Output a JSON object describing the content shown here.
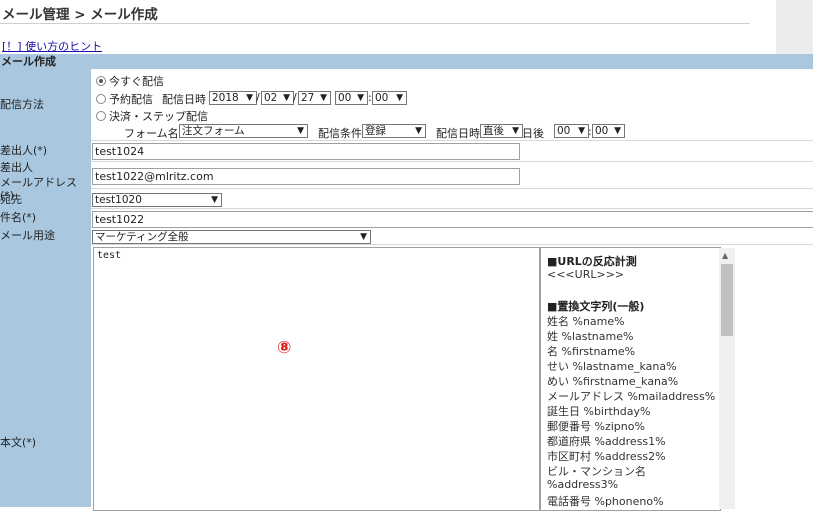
{
  "page": {
    "title": "メール管理 > メール作成",
    "hint_link": "[！] 使い方のヒント",
    "section_title": "メール作成"
  },
  "delivery": {
    "label": "配信方法",
    "opt_now": "今すぐ配信",
    "opt_scheduled": "予約配信",
    "schedule_label": "配信日時",
    "year": "2018",
    "month": "02",
    "day": "27",
    "hour": "00",
    "minute": "00",
    "sep_slash": "/",
    "sep_colon": ":",
    "opt_step": "決済・ステップ配信",
    "form_name_label": "フォーム名",
    "form_name_value": "注文フォーム",
    "condition_label": "配信条件",
    "condition_value": "登録",
    "step_time_label": "配信日時",
    "step_time_value": "直後",
    "days_after": "日後",
    "step_hour": "00",
    "step_minute": "00",
    "selected": "now"
  },
  "sender": {
    "label": "差出人(*)",
    "value": "test1024"
  },
  "sender_address": {
    "label_line1": "差出人",
    "label_line2": "メールアドレス(*)",
    "value": "test1022@mlritz.com"
  },
  "recipient": {
    "label": "宛先",
    "value": "test1020"
  },
  "subject": {
    "label": "件名(*)",
    "value": "test1022"
  },
  "purpose": {
    "label": "メール用途",
    "value": "マーケティング全般"
  },
  "body": {
    "label": "本文(*)",
    "value": "test",
    "marker": "⑧"
  },
  "side_panel": {
    "lines": [
      {
        "text": "■URLの反応計測",
        "heading": true
      },
      {
        "text": "<<<URL>>>",
        "heading": false
      },
      {
        "text": "",
        "heading": false
      },
      {
        "text": "■置換文字列(一般)",
        "heading": true
      },
      {
        "text": "姓名 %name%",
        "heading": false
      },
      {
        "text": "姓 %lastname%",
        "heading": false
      },
      {
        "text": "名 %firstname%",
        "heading": false
      },
      {
        "text": "せい %lastname_kana%",
        "heading": false
      },
      {
        "text": "めい %firstname_kana%",
        "heading": false
      },
      {
        "text": "メールアドレス %mailaddress%",
        "heading": false
      },
      {
        "text": "誕生日 %birthday%",
        "heading": false
      },
      {
        "text": "郵便番号 %zipno%",
        "heading": false
      },
      {
        "text": "都道府県 %address1%",
        "heading": false
      },
      {
        "text": "市区町村 %address2%",
        "heading": false
      },
      {
        "text": "ビル・マンション名",
        "heading": false
      },
      {
        "text": "%address3%",
        "heading": false
      },
      {
        "text": "電話番号 %phoneno%",
        "heading": false
      }
    ]
  },
  "colors": {
    "label_column": "#a9c8e0",
    "marker": "#e02020",
    "link": "#1a0dab"
  }
}
